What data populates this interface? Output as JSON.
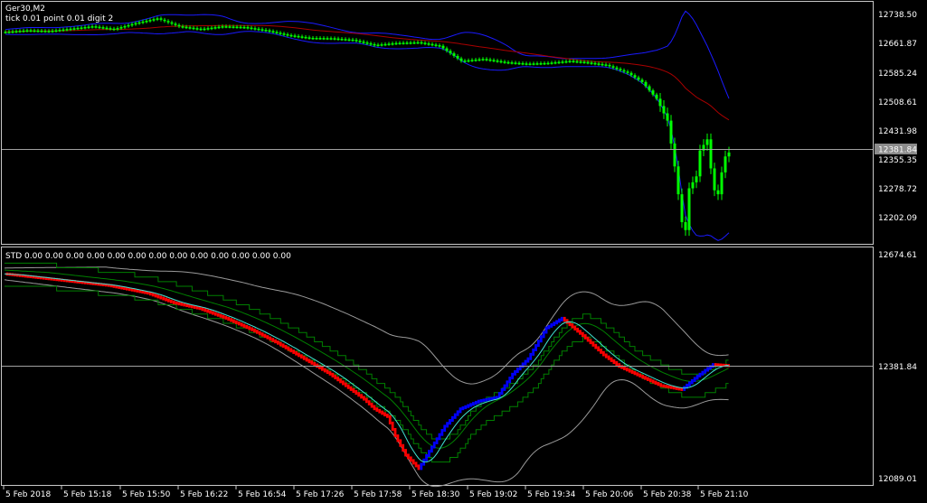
{
  "upper_panel": {
    "symbol_label": "Ger30,M2",
    "info_label": "tick 0.01 point 0.01 digit 2",
    "price_ticks": [
      "12738.50",
      "12661.87",
      "12585.24",
      "12508.61",
      "12431.98",
      "12355.35",
      "12278.72",
      "12202.09"
    ],
    "current_price_label": "12381.84",
    "colors": {
      "bars": "#00ff00",
      "upper_band": "#1a1aff",
      "lower_band": "#1a1aff",
      "middle_line": "#aa0000",
      "level_line": "#a0a0a0",
      "price_box": "#8c8c8c"
    }
  },
  "lower_panel": {
    "indicator_label": "STD 0.00 0.00 0.00 0.00 0.00 0.00 0.00 0.00 0.00 0.00 0.00 0.00 0.00",
    "price_ticks": [
      "12674.61",
      "12381.84",
      "12089.01"
    ],
    "colors": {
      "bull": "#0000ff",
      "bear": "#ff0000",
      "fast_line": "#40e0d0",
      "green_lines": "#008000",
      "outer_band": "#9a9a9a",
      "level_line": "#a0a0a0"
    }
  },
  "time_axis": {
    "labels": [
      "5 Feb 2018",
      "5 Feb 15:18",
      "5 Feb 15:50",
      "5 Feb 16:22",
      "5 Feb 16:54",
      "5 Feb 17:26",
      "5 Feb 17:58",
      "5 Feb 18:30",
      "5 Feb 19:02",
      "5 Feb 19:34",
      "5 Feb 20:06",
      "5 Feb 20:38",
      "5 Feb 21:10"
    ]
  },
  "chart_data": [
    {
      "type": "candlestick",
      "ylim": [
        12170,
        12760
      ],
      "anchor_closes": [
        [
          0,
          12698
        ],
        [
          6,
          12702
        ],
        [
          12,
          12700
        ],
        [
          18,
          12706
        ],
        [
          24,
          12712
        ],
        [
          30,
          12705
        ],
        [
          36,
          12720
        ],
        [
          42,
          12732
        ],
        [
          48,
          12712
        ],
        [
          54,
          12705
        ],
        [
          60,
          12712
        ],
        [
          66,
          12710
        ],
        [
          72,
          12702
        ],
        [
          78,
          12690
        ],
        [
          84,
          12683
        ],
        [
          90,
          12682
        ],
        [
          96,
          12678
        ],
        [
          102,
          12665
        ],
        [
          108,
          12670
        ],
        [
          114,
          12672
        ],
        [
          120,
          12663
        ],
        [
          126,
          12625
        ],
        [
          132,
          12630
        ],
        [
          138,
          12622
        ],
        [
          144,
          12618
        ],
        [
          150,
          12620
        ],
        [
          156,
          12625
        ],
        [
          160,
          12622
        ],
        [
          166,
          12615
        ],
        [
          172,
          12595
        ],
        [
          176,
          12572
        ],
        [
          180,
          12530
        ],
        [
          183,
          12475
        ],
        [
          185,
          12360
        ],
        [
          187,
          12220
        ],
        [
          188,
          12200
        ],
        [
          189,
          12305
        ],
        [
          191,
          12335
        ],
        [
          192,
          12400
        ],
        [
          194,
          12428
        ],
        [
          195,
          12355
        ],
        [
          196,
          12300
        ],
        [
          197,
          12290
        ],
        [
          198,
          12345
        ],
        [
          199,
          12385
        ],
        [
          200,
          12395
        ]
      ]
    },
    {
      "type": "renko",
      "ylim": [
        12089.01,
        12674.61
      ],
      "anchor_closes": [
        [
          0,
          12620
        ],
        [
          20,
          12605
        ],
        [
          40,
          12590
        ],
        [
          55,
          12570
        ],
        [
          65,
          12545
        ],
        [
          75,
          12530
        ],
        [
          85,
          12505
        ],
        [
          95,
          12475
        ],
        [
          105,
          12440
        ],
        [
          115,
          12400
        ],
        [
          125,
          12360
        ],
        [
          132,
          12325
        ],
        [
          138,
          12295
        ],
        [
          142,
          12270
        ],
        [
          147,
          12250
        ],
        [
          150,
          12200
        ],
        [
          154,
          12150
        ],
        [
          159,
          12115
        ],
        [
          163,
          12160
        ],
        [
          169,
          12225
        ],
        [
          175,
          12270
        ],
        [
          182,
          12290
        ],
        [
          189,
          12300
        ],
        [
          195,
          12360
        ],
        [
          201,
          12400
        ],
        [
          208,
          12480
        ],
        [
          214,
          12505
        ],
        [
          222,
          12460
        ],
        [
          230,
          12410
        ],
        [
          236,
          12380
        ],
        [
          244,
          12355
        ],
        [
          252,
          12330
        ],
        [
          260,
          12320
        ],
        [
          266,
          12355
        ],
        [
          272,
          12385
        ],
        [
          278,
          12382
        ]
      ]
    }
  ]
}
